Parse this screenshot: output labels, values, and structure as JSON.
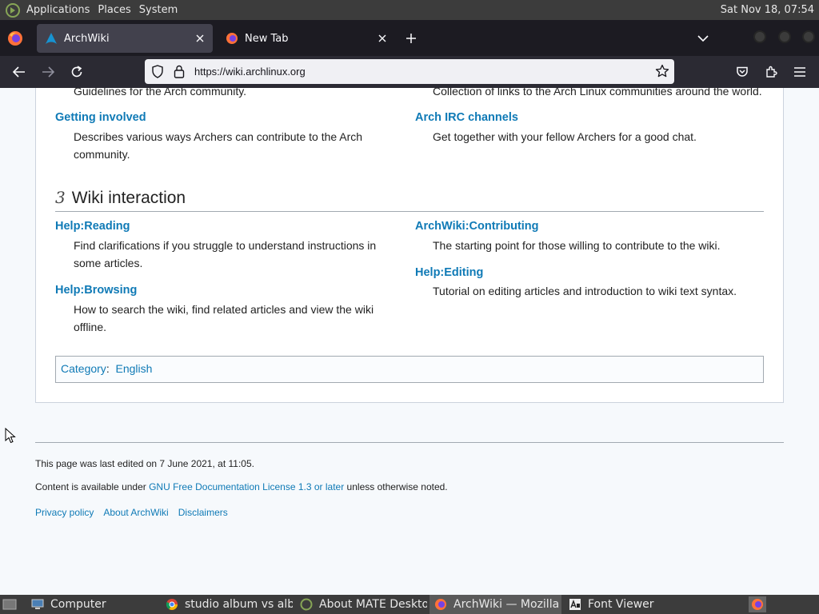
{
  "top_panel": {
    "menus": [
      "Applications",
      "Places",
      "System"
    ],
    "clock": "Sat Nov 18, 07:54"
  },
  "browser": {
    "tabs": [
      {
        "title": "ArchWiki",
        "active": true
      },
      {
        "title": "New Tab",
        "active": false
      }
    ],
    "url": "https://wiki.archlinux.org"
  },
  "page": {
    "top_left_desc": "Guidelines for the Arch community.",
    "top_right_desc": "Collection of links to the Arch Linux communities around the world.",
    "getting_involved": {
      "title": "Getting involved",
      "desc_line1": "Describes various ways Archers can contribute to the Arch",
      "desc_line2": "community."
    },
    "irc": {
      "title": "Arch IRC channels",
      "desc": "Get together with your fellow Archers for a good chat."
    },
    "section": {
      "number": "3",
      "title": "Wiki interaction"
    },
    "help_reading": {
      "title": "Help:Reading",
      "desc_line1": "Find clarifications if you struggle to understand instructions in",
      "desc_line2": "some articles."
    },
    "help_browsing": {
      "title": "Help:Browsing",
      "desc_line1": "How to search the wiki, find related articles and view the wiki",
      "desc_line2": "offline."
    },
    "contributing": {
      "title": "ArchWiki:Contributing",
      "desc": "The starting point for those willing to contribute to the wiki."
    },
    "help_editing": {
      "title": "Help:Editing",
      "desc": "Tutorial on editing articles and introduction to wiki text syntax."
    },
    "category": {
      "label": "Category",
      "sep": ":",
      "value": "English"
    },
    "footer": {
      "last_edited": "This page was last edited on 7 June 2021, at 11:05.",
      "content_prefix": "Content is available under ",
      "license": "GNU Free Documentation License 1.3 or later",
      "content_suffix": " unless otherwise noted.",
      "links": [
        "Privacy policy",
        "About ArchWiki",
        "Disclaimers"
      ]
    }
  },
  "taskbar": {
    "tasks": [
      {
        "label": "Computer",
        "active": false
      },
      {
        "label": "studio album vs alb…",
        "active": false
      },
      {
        "label": "About MATE Deskto…",
        "active": false
      },
      {
        "label": "ArchWiki — Mozilla …",
        "active": true
      },
      {
        "label": "Font Viewer",
        "active": false
      }
    ]
  },
  "colors": {
    "link": "#0f7ab6",
    "panel": "#3c3c3c",
    "firefox_toolbar": "#2b2a33",
    "firefox_tabstrip": "#1c1b22"
  }
}
